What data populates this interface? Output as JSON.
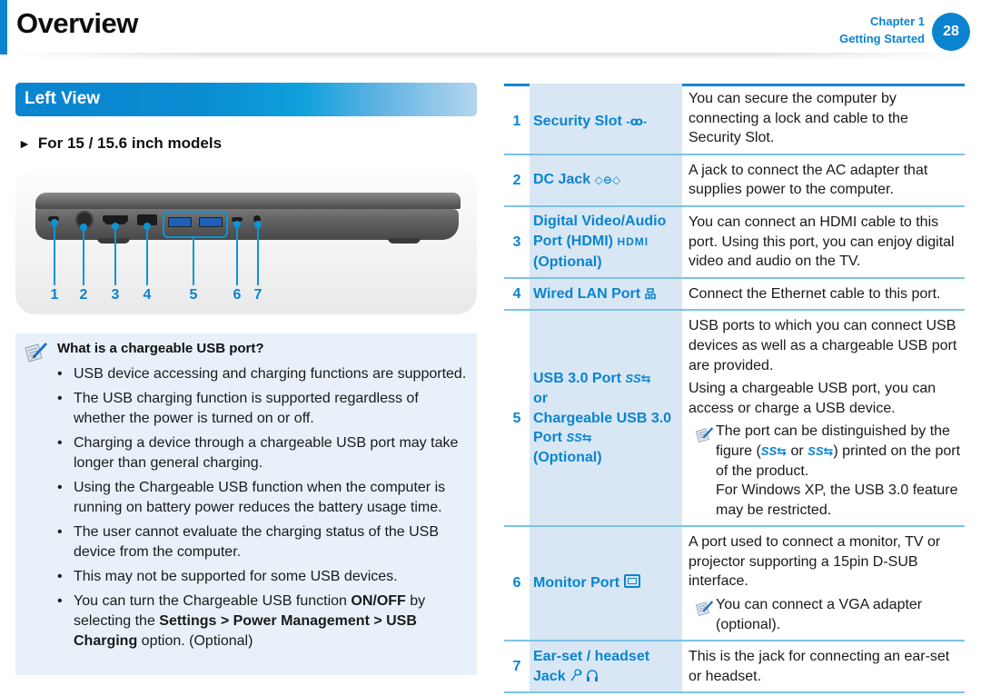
{
  "header": {
    "title": "Overview",
    "chapter": "Chapter 1",
    "chapter_name": "Getting Started",
    "page_number": "28"
  },
  "section": {
    "title": "Left View",
    "subheading": "For 15 / 15.6 inch models",
    "subheading_marker": "►"
  },
  "figure": {
    "callouts": [
      "1",
      "2",
      "3",
      "4",
      "5",
      "6",
      "7"
    ]
  },
  "note": {
    "title": "What is a chargeable USB port?",
    "bullet": "•",
    "items": [
      "USB device accessing and charging functions are supported.",
      "The USB charging function is supported regardless of whether the power is turned on or off.",
      "Charging a device through a chargeable USB port may take longer than general charging.",
      "Using the Chargeable USB function when the computer is running on battery power reduces the battery usage time.",
      "The user cannot evaluate the charging status of the USB device from the computer.",
      "This may not be supported for some USB devices."
    ],
    "last_item": {
      "prefix": "You can turn the Chargeable USB function ",
      "bold1": "ON/OFF",
      "mid": " by selecting the ",
      "bold2": "Settings > Power Management > USB Charging",
      "suffix": " option. (Optional)"
    }
  },
  "table": {
    "rows": [
      {
        "num": "1",
        "name": "Security Slot",
        "icon": "-ꝏ-",
        "desc": [
          "You can secure the computer by connecting a lock and cable to the Security Slot."
        ]
      },
      {
        "num": "2",
        "name": "DC Jack",
        "icon": "◇⊖◇",
        "desc": [
          "A jack to connect the AC adapter that supplies power to the computer."
        ]
      },
      {
        "num": "3",
        "name": "Digital Video/Audio Port (HDMI)",
        "icon": "HDMI",
        "name_suffix": "(Optional)",
        "desc": [
          "You can connect an HDMI cable to this port. Using this port, you can enjoy digital video and audio on the TV."
        ]
      },
      {
        "num": "4",
        "name": "Wired LAN Port",
        "icon": "品",
        "desc": [
          "Connect the Ethernet cable to this port."
        ]
      },
      {
        "num": "5",
        "name": "USB 3.0 Port",
        "icon": "SS⇆",
        "name_or": "or",
        "name2": "Chargeable USB 3.0 Port",
        "icon2": "SS⇆",
        "name_suffix": "(Optional)",
        "desc": [
          "USB ports to which you can connect USB devices as well as a chargeable USB port are provided.",
          "Using a chargeable USB port, you can access or charge a USB device."
        ],
        "note": {
          "prefix": "The port can be distinguished by the figure (",
          "icon_a": "SS⇆",
          "or": " or ",
          "icon_b": "SS⇆",
          "suffix": ") printed on the port of the product.",
          "extra": "For Windows XP, the USB 3.0 feature may be restricted."
        }
      },
      {
        "num": "6",
        "name": "Monitor Port",
        "icon": "monitor",
        "desc": [
          "A port used to connect a monitor, TV or projector supporting a 15pin D-SUB interface."
        ],
        "note": {
          "text": "You can connect a VGA adapter (optional)."
        }
      },
      {
        "num": "7",
        "name": "Ear-set / headset Jack",
        "icon": "🎤🎧",
        "desc": [
          "This is the jack for connecting an ear-set or headset."
        ]
      }
    ]
  },
  "colors": {
    "accent": "#0a84cf",
    "name_cell_bg": "#d9e7f5",
    "note_bg": "#e8f1fa",
    "row_divider": "#7cc3ea"
  }
}
